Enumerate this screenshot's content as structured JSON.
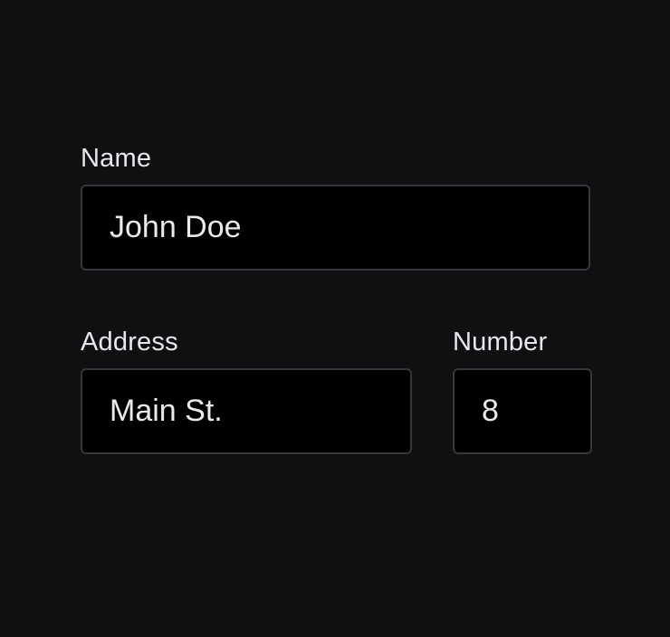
{
  "form": {
    "name": {
      "label": "Name",
      "value": "John Doe"
    },
    "address": {
      "label": "Address",
      "value": "Main St."
    },
    "number": {
      "label": "Number",
      "value": "8"
    }
  },
  "colors": {
    "background": "#0f1012",
    "input_background": "#000000",
    "input_border": "#34373c",
    "text": "#e6e8eb"
  }
}
